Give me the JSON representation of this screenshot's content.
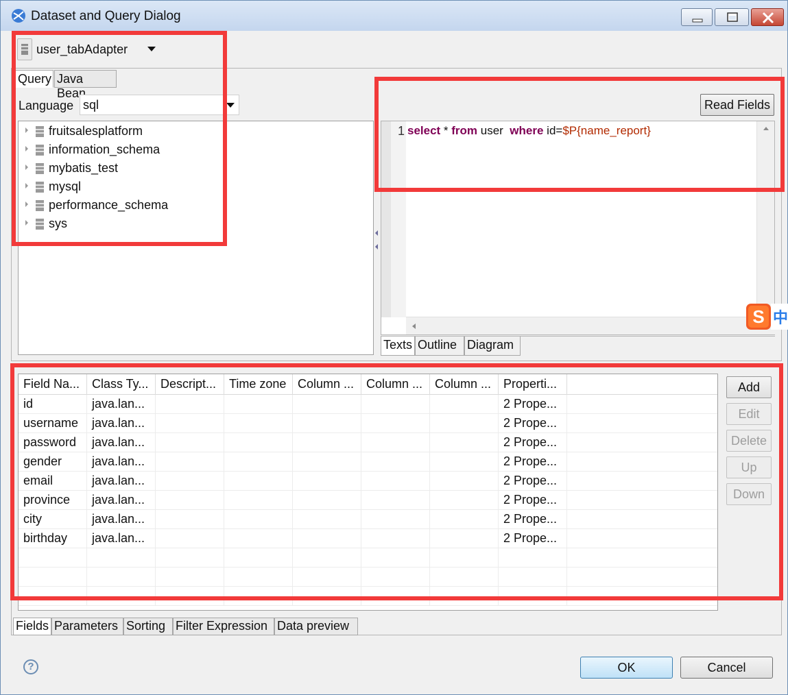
{
  "window": {
    "title": "Dataset and Query Dialog"
  },
  "dataset_selector": {
    "value": "user_tabAdapter"
  },
  "left_tabs": [
    {
      "label": "Query",
      "active": true
    },
    {
      "label": "Java Bean",
      "active": false
    }
  ],
  "language": {
    "label": "Language",
    "value": "sql"
  },
  "tree_items": [
    "fruitsalesplatform",
    "information_schema",
    "mybatis_test",
    "mysql",
    "performance_schema",
    "sys"
  ],
  "editor": {
    "read_fields_label": "Read Fields",
    "line_number": "1",
    "query_parts": {
      "kw_select": "select",
      "star": " * ",
      "kw_from": "from",
      "table": " user  ",
      "kw_where": "where",
      "cond": " id=",
      "param": "$P{name_report}"
    },
    "tabs": [
      "Texts",
      "Outline",
      "Diagram"
    ]
  },
  "ime_badge": {
    "letter": "S",
    "char": "中"
  },
  "fields_table": {
    "columns": [
      "Field Na...",
      "Class Ty...",
      "Descript...",
      "Time zone",
      "Column ...",
      "Column ...",
      "Column ...",
      "Properti..."
    ],
    "rows": [
      {
        "name": "id",
        "class": "java.lan...",
        "props": "2 Prope..."
      },
      {
        "name": "username",
        "class": "java.lan...",
        "props": "2 Prope..."
      },
      {
        "name": "password",
        "class": "java.lan...",
        "props": "2 Prope..."
      },
      {
        "name": "gender",
        "class": "java.lan...",
        "props": "2 Prope..."
      },
      {
        "name": "email",
        "class": "java.lan...",
        "props": "2 Prope..."
      },
      {
        "name": "province",
        "class": "java.lan...",
        "props": "2 Prope..."
      },
      {
        "name": "city",
        "class": "java.lan...",
        "props": "2 Prope..."
      },
      {
        "name": "birthday",
        "class": "java.lan...",
        "props": "2 Prope..."
      }
    ]
  },
  "side_buttons": {
    "add": "Add",
    "edit": "Edit",
    "delete": "Delete",
    "up": "Up",
    "down": "Down"
  },
  "bottom_tabs": [
    "Fields",
    "Parameters",
    "Sorting",
    "Filter Expression",
    "Data preview"
  ],
  "footer": {
    "help": "?",
    "ok": "OK",
    "cancel": "Cancel"
  },
  "colors": {
    "highlight": "#f23a3a",
    "keyword": "#7f0055",
    "parameter": "#b22a00"
  }
}
